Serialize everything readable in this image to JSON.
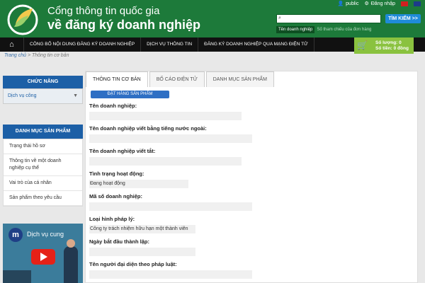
{
  "header": {
    "logo_line1": "Cổng thông tin quốc gia",
    "logo_line2": "về đăng ký doanh nghiệp",
    "user_link": "public",
    "login_link": "Đăng nhập",
    "search_button": "TÌM KIẾM >>",
    "search_tab_active": "Tên doanh nghiệp",
    "search_tab_other": "Số tham chiếu của đơn hàng"
  },
  "nav": {
    "items": [
      "CÔNG BỐ NỘI DUNG ĐĂNG KÝ DOANH NGHIỆP",
      "DỊCH VỤ THÔNG TIN",
      "ĐĂNG KÝ DOANH NGHIỆP QUA MẠNG ĐIỆN TỬ"
    ]
  },
  "cart": {
    "quantity": "Số lượng: 0",
    "amount": "Số tiền: 0 đồng"
  },
  "breadcrumb": {
    "home": "Trang chủ",
    "separator": " > ",
    "current": "Thông tin cơ bản"
  },
  "sidebar": {
    "functions_title": "CHỨC NĂNG",
    "service_select": "Dịch vụ công",
    "products_title": "DANH MỤC SẢN PHẨM",
    "products": [
      "Trạng thái hồ sơ",
      "Thông tin về một doanh nghiệp cụ thể",
      "Vai trò của cá nhân",
      "Sản phẩm theo yêu cầu"
    ],
    "video_title": "Dịch vụ cung"
  },
  "tabs": [
    "THÔNG TIN CƠ BẢN",
    "BỐ CÁO ĐIỆN TỬ",
    "DANH MỤC SẢN PHẨM"
  ],
  "order_button": "ĐẶT HÀNG SẢN PHẨM",
  "fields": {
    "name_label": "Tên doanh nghiệp:",
    "foreign_name_label": "Tên doanh nghiệp viết bằng tiếng nước ngoài:",
    "short_name_label": "Tên doanh nghiệp viết tắt:",
    "status_label": "Tình trạng hoạt động:",
    "status_value": "Đang hoạt động",
    "tax_code_label": "Mã số doanh nghiệp:",
    "type_label": "Loại hình pháp lý:",
    "type_value": "Công ty trách nhiệm hữu hạn một thành viên",
    "start_date_label": "Ngày bắt đầu thành lập:",
    "rep_label": "Tên người đại diện theo pháp luật:"
  }
}
